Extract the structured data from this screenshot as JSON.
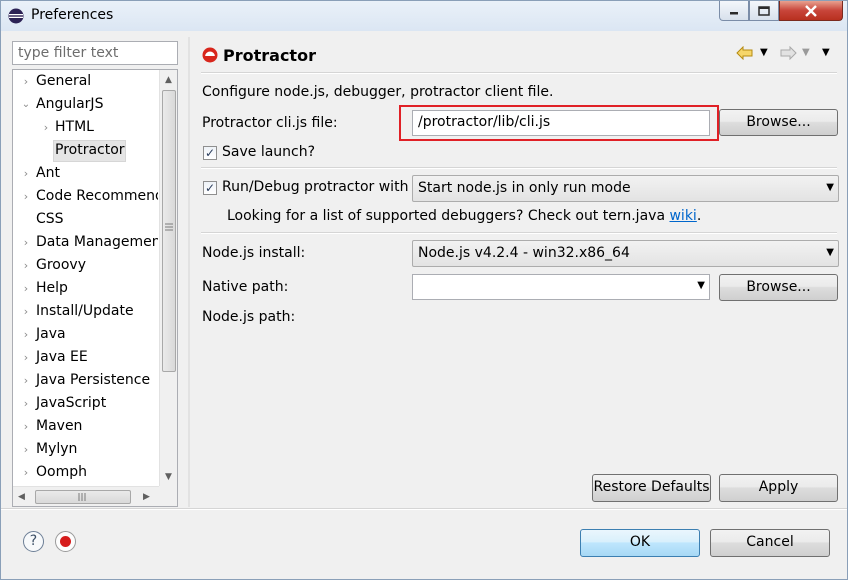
{
  "window": {
    "title": "Preferences"
  },
  "filter": {
    "placeholder": "type filter text"
  },
  "tree": {
    "items": [
      {
        "label": "General",
        "expander": "›"
      },
      {
        "label": "AngularJS",
        "expander": "⌄"
      },
      {
        "label": "HTML",
        "expander": "›"
      },
      {
        "label": "Protractor",
        "expander": ""
      },
      {
        "label": "Ant",
        "expander": "›"
      },
      {
        "label": "Code Recommend",
        "expander": "›"
      },
      {
        "label": "CSS",
        "expander": ""
      },
      {
        "label": "Data Management",
        "expander": "›"
      },
      {
        "label": "Groovy",
        "expander": "›"
      },
      {
        "label": "Help",
        "expander": "›"
      },
      {
        "label": "Install/Update",
        "expander": "›"
      },
      {
        "label": "Java",
        "expander": "›"
      },
      {
        "label": "Java EE",
        "expander": "›"
      },
      {
        "label": "Java Persistence",
        "expander": "›"
      },
      {
        "label": "JavaScript",
        "expander": "›"
      },
      {
        "label": "Maven",
        "expander": "›"
      },
      {
        "label": "Mylyn",
        "expander": "›"
      },
      {
        "label": "Oomph",
        "expander": "›"
      }
    ]
  },
  "page": {
    "title": "Protractor",
    "description": "Configure node.js, debugger, protractor client file.",
    "cli_label": "Protractor cli.js file:",
    "cli_value": "/protractor/lib/cli.js",
    "browse1": "Browse...",
    "save_launch": "Save launch?",
    "run_debug_label": "Run/Debug protractor with",
    "run_mode": "Start node.js in only run mode",
    "debuggers_text": "Looking for a list of supported debuggers? Check out tern.java ",
    "wiki_link": "wiki",
    "debuggers_period": ".",
    "nodejs_install_label": "Node.js install:",
    "nodejs_install_value": "Node.js v4.2.4 - win32.x86_64",
    "native_path_label": "Native path:",
    "native_path_value": "",
    "browse2": "Browse...",
    "nodejs_path_label": "Node.js path:",
    "restore_defaults": "Restore Defaults",
    "apply": "Apply"
  },
  "footer": {
    "ok": "OK",
    "cancel": "Cancel"
  },
  "colors": {
    "highlight_box": "#e02026",
    "link": "#0066cc"
  }
}
